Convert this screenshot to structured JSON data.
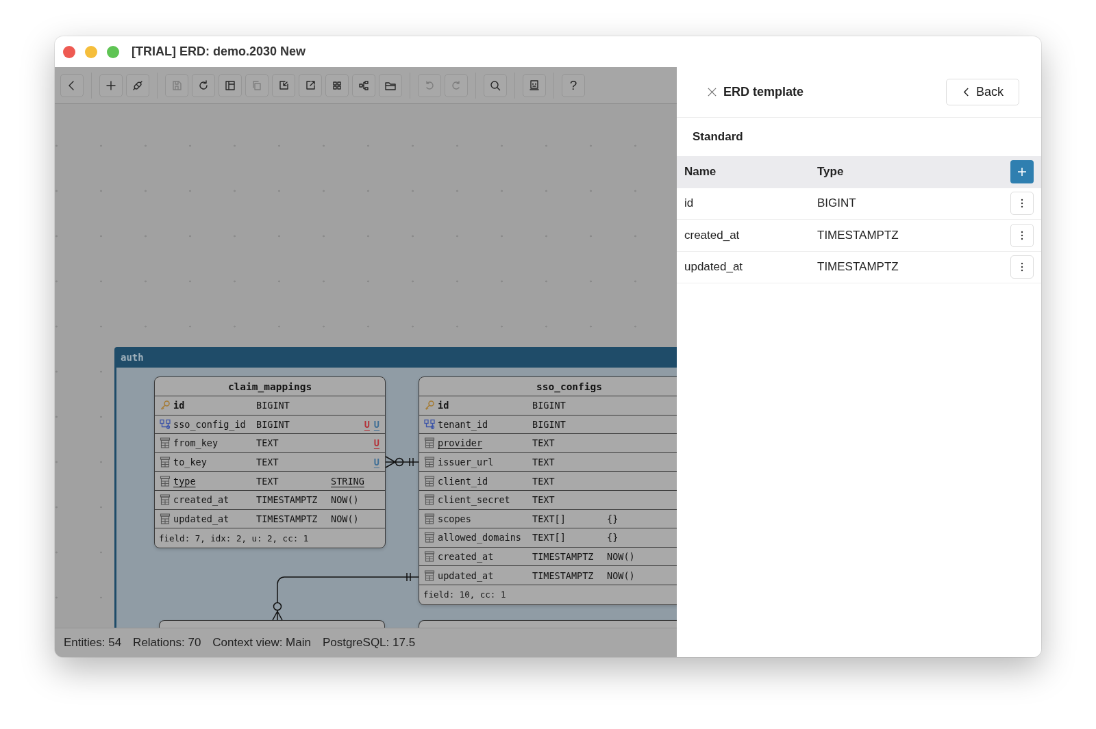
{
  "window": {
    "title": "[TRIAL] ERD: demo.2030 New"
  },
  "toolbar_groups": [
    {
      "buttons": [
        {
          "kind": "back",
          "disabled": false
        }
      ]
    },
    {
      "buttons": [
        {
          "kind": "add",
          "disabled": false
        },
        {
          "kind": "link",
          "disabled": false
        }
      ]
    },
    {
      "buttons": [
        {
          "kind": "save",
          "disabled": true
        },
        {
          "kind": "refresh",
          "disabled": false
        },
        {
          "kind": "panel",
          "disabled": false
        },
        {
          "kind": "copy",
          "disabled": true
        },
        {
          "kind": "import",
          "disabled": false
        },
        {
          "kind": "export",
          "disabled": false
        },
        {
          "kind": "grid",
          "disabled": false
        },
        {
          "kind": "diagram",
          "disabled": false
        },
        {
          "kind": "folder",
          "disabled": false
        }
      ]
    },
    {
      "buttons": [
        {
          "kind": "undo",
          "disabled": true
        },
        {
          "kind": "redo",
          "disabled": true
        }
      ]
    },
    {
      "buttons": [
        {
          "kind": "search",
          "disabled": false
        }
      ]
    },
    {
      "buttons": [
        {
          "kind": "terminal",
          "disabled": false
        }
      ]
    },
    {
      "buttons": [
        {
          "kind": "help",
          "label": "?",
          "disabled": false
        }
      ]
    }
  ],
  "canvas": {
    "group": {
      "name": "auth"
    },
    "entities": [
      {
        "name": "claim_mappings",
        "columns": [
          {
            "kind": "pk",
            "name": "id",
            "type": "BIGINT",
            "underlined": false
          },
          {
            "kind": "fk",
            "name": "sso_config_id",
            "type": "BIGINT",
            "underlined": false,
            "badges": [
              {
                "text": "U",
                "color": "#b3343a"
              },
              {
                "text": "U",
                "color": "#3f6f96"
              }
            ]
          },
          {
            "kind": "column",
            "name": "from_key",
            "type": "TEXT",
            "underlined": false,
            "badges": [
              {
                "text": "U",
                "color": "#b3343a"
              }
            ]
          },
          {
            "kind": "column",
            "name": "to_key",
            "type": "TEXT",
            "underlined": false,
            "badges": [
              {
                "text": "U",
                "color": "#3f6f96"
              }
            ]
          },
          {
            "kind": "column",
            "name": "type",
            "type": "TEXT",
            "default": "STRING",
            "underlined": true,
            "default_underlined": true
          },
          {
            "kind": "column",
            "name": "created_at",
            "type": "TIMESTAMPTZ",
            "default": "NOW()",
            "underlined": false
          },
          {
            "kind": "column",
            "name": "updated_at",
            "type": "TIMESTAMPTZ",
            "default": "NOW()",
            "underlined": false
          }
        ],
        "footer": "field: 7, idx: 2, u: 2, cc: 1"
      },
      {
        "name": "sso_configs",
        "columns": [
          {
            "kind": "pk",
            "name": "id",
            "type": "BIGINT",
            "underlined": false
          },
          {
            "kind": "fk",
            "name": "tenant_id",
            "type": "BIGINT",
            "underlined": false
          },
          {
            "kind": "column",
            "name": "provider",
            "type": "TEXT",
            "underlined": true
          },
          {
            "kind": "column",
            "name": "issuer_url",
            "type": "TEXT",
            "underlined": false
          },
          {
            "kind": "column",
            "name": "client_id",
            "type": "TEXT",
            "underlined": false
          },
          {
            "kind": "column",
            "name": "client_secret",
            "type": "TEXT",
            "underlined": false
          },
          {
            "kind": "column",
            "name": "scopes",
            "type": "TEXT[]",
            "default": "{}",
            "underlined": false
          },
          {
            "kind": "column",
            "name": "allowed_domains",
            "type": "TEXT[]",
            "default": "{}",
            "underlined": false
          },
          {
            "kind": "column",
            "name": "created_at",
            "type": "TIMESTAMPTZ",
            "default": "NOW()",
            "underlined": false
          },
          {
            "kind": "column",
            "name": "updated_at",
            "type": "TIMESTAMPTZ",
            "default": "NOW()",
            "underlined": false
          }
        ],
        "footer": "field: 10, cc: 1"
      }
    ]
  },
  "status_bar": [
    "Entities: 54",
    "Relations: 70",
    "Context view: Main",
    "PostgreSQL: 17.5"
  ],
  "template_panel": {
    "title": "ERD template",
    "back_label": "Back",
    "section": "Standard",
    "columns": [
      "Name",
      "Type"
    ],
    "rows": [
      {
        "name": "id",
        "type": "BIGINT"
      },
      {
        "name": "created_at",
        "type": "TIMESTAMPTZ"
      },
      {
        "name": "updated_at",
        "type": "TIMESTAMPTZ"
      }
    ]
  }
}
